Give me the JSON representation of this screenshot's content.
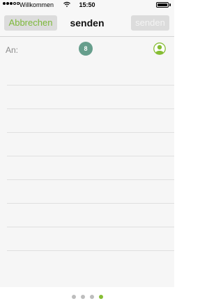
{
  "status_bar": {
    "carrier": "Willkommen",
    "time": "15:50",
    "signal_dots_filled": 3,
    "signal_dots_total": 5,
    "battery_level": 1.0,
    "wifi_icon": "wifi-icon",
    "battery_icon": "battery-icon"
  },
  "nav": {
    "cancel_label": "Abbrechen",
    "title": "senden",
    "send_label": "senden"
  },
  "compose": {
    "to_label": "An:",
    "recipient_count": "8",
    "add_contact_icon": "person-icon",
    "ruled_lines": 8
  },
  "pager": {
    "pages": 4,
    "active_index": 3
  },
  "colors": {
    "accent_green": "#86bd34",
    "badge": "#669e8c",
    "button_bg": "#dcdcdc",
    "background": "#f6f6f6"
  }
}
